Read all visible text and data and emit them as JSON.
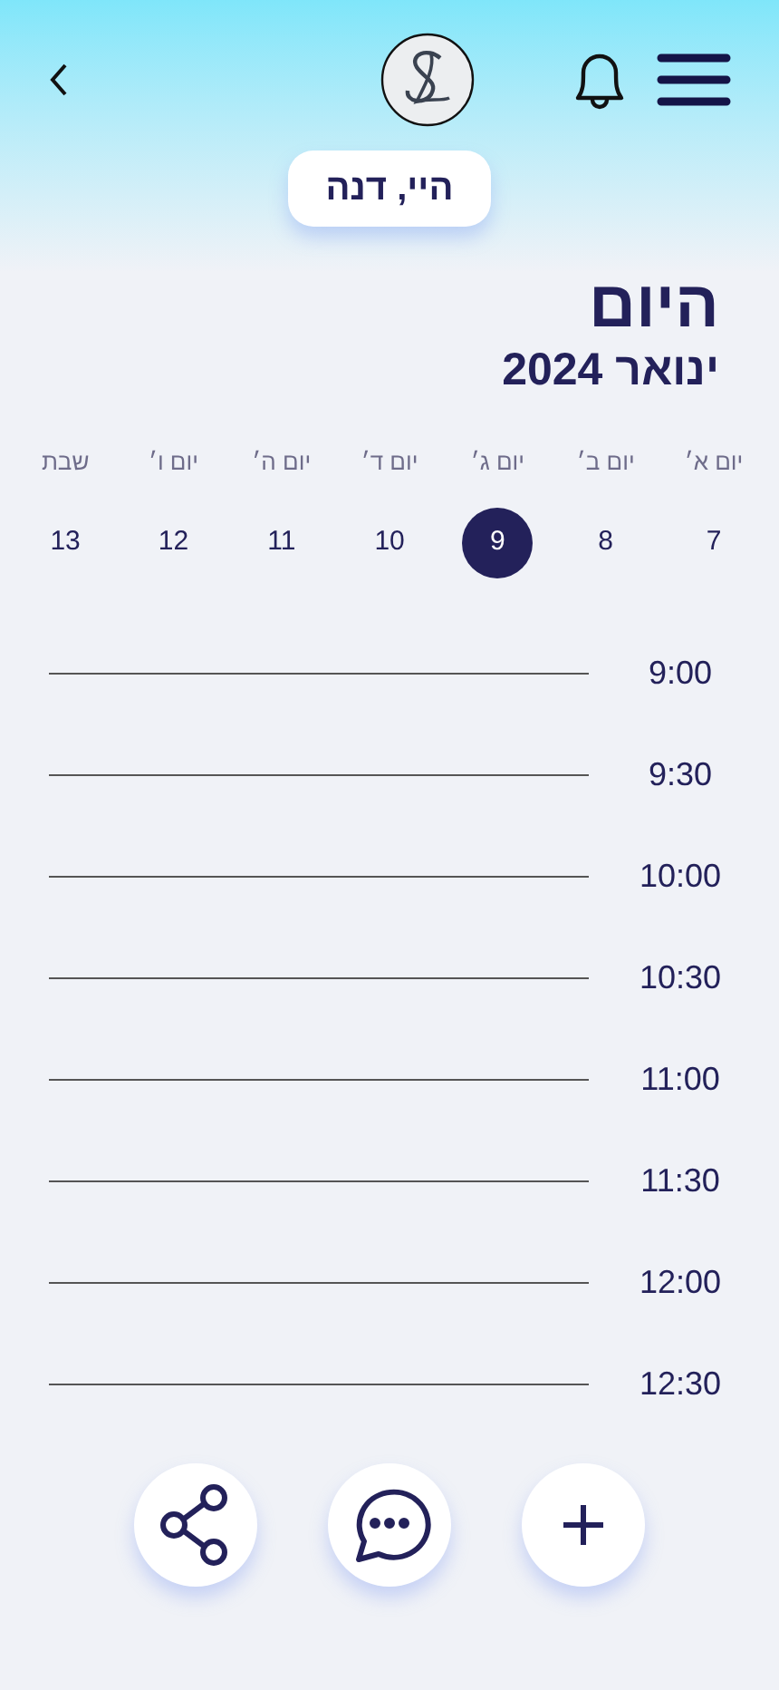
{
  "greeting": "היי, דנה",
  "title": "היום",
  "month": "ינואר 2024",
  "days": [
    {
      "label": "יום א׳",
      "date": "7",
      "selected": false
    },
    {
      "label": "יום ב׳",
      "date": "8",
      "selected": false
    },
    {
      "label": "יום ג׳",
      "date": "9",
      "selected": true
    },
    {
      "label": "יום ד׳",
      "date": "10",
      "selected": false
    },
    {
      "label": "יום ה׳",
      "date": "11",
      "selected": false
    },
    {
      "label": "יום ו׳",
      "date": "12",
      "selected": false
    },
    {
      "label": "שבת",
      "date": "13",
      "selected": false
    }
  ],
  "times": [
    "9:00",
    "9:30",
    "10:00",
    "10:30",
    "11:00",
    "11:30",
    "12:00",
    "12:30"
  ],
  "actions": [
    {
      "kind": "share"
    },
    {
      "kind": "chat"
    },
    {
      "kind": "add"
    }
  ]
}
